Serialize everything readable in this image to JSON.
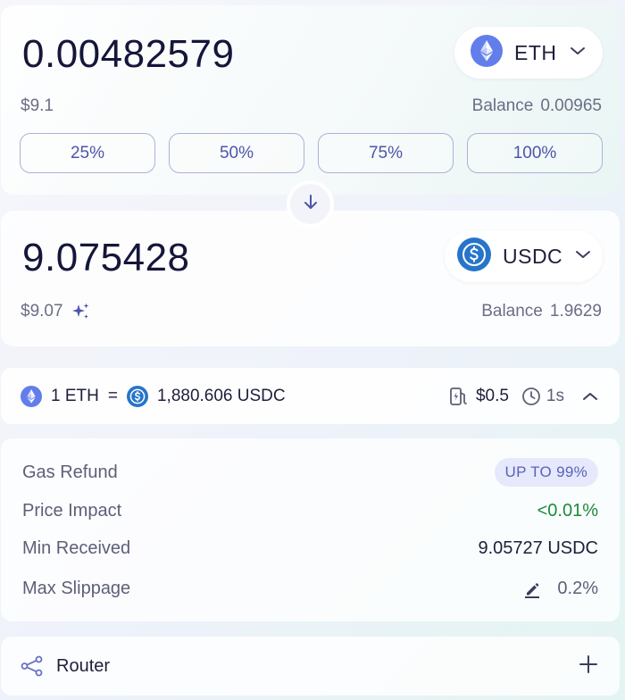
{
  "from": {
    "amount": "0.00482579",
    "usd": "$9.1",
    "balance_label": "Balance",
    "balance_value": "0.00965",
    "token": "ETH",
    "token_icon": "ethereum-icon",
    "percent_buttons": [
      "25%",
      "50%",
      "75%",
      "100%"
    ]
  },
  "to": {
    "amount": "9.075428",
    "usd": "$9.07",
    "balance_label": "Balance",
    "balance_value": "1.9629",
    "token": "USDC",
    "token_icon": "usdc-icon"
  },
  "rate": {
    "from_amount": "1 ETH",
    "equals": "=",
    "to_amount": "1,880.606 USDC",
    "gas_cost": "$0.5",
    "time": "1s"
  },
  "details": {
    "gas_refund_label": "Gas Refund",
    "gas_refund_value": "UP TO 99%",
    "price_impact_label": "Price Impact",
    "price_impact_value": "<0.01%",
    "min_received_label": "Min Received",
    "min_received_value": "9.05727 USDC",
    "max_slippage_label": "Max Slippage",
    "max_slippage_value": "0.2%"
  },
  "router": {
    "label": "Router"
  },
  "colors": {
    "accent": "#4e55a8",
    "eth": "#627eea",
    "usdc": "#2775ca",
    "positive": "#1e8a3a"
  }
}
